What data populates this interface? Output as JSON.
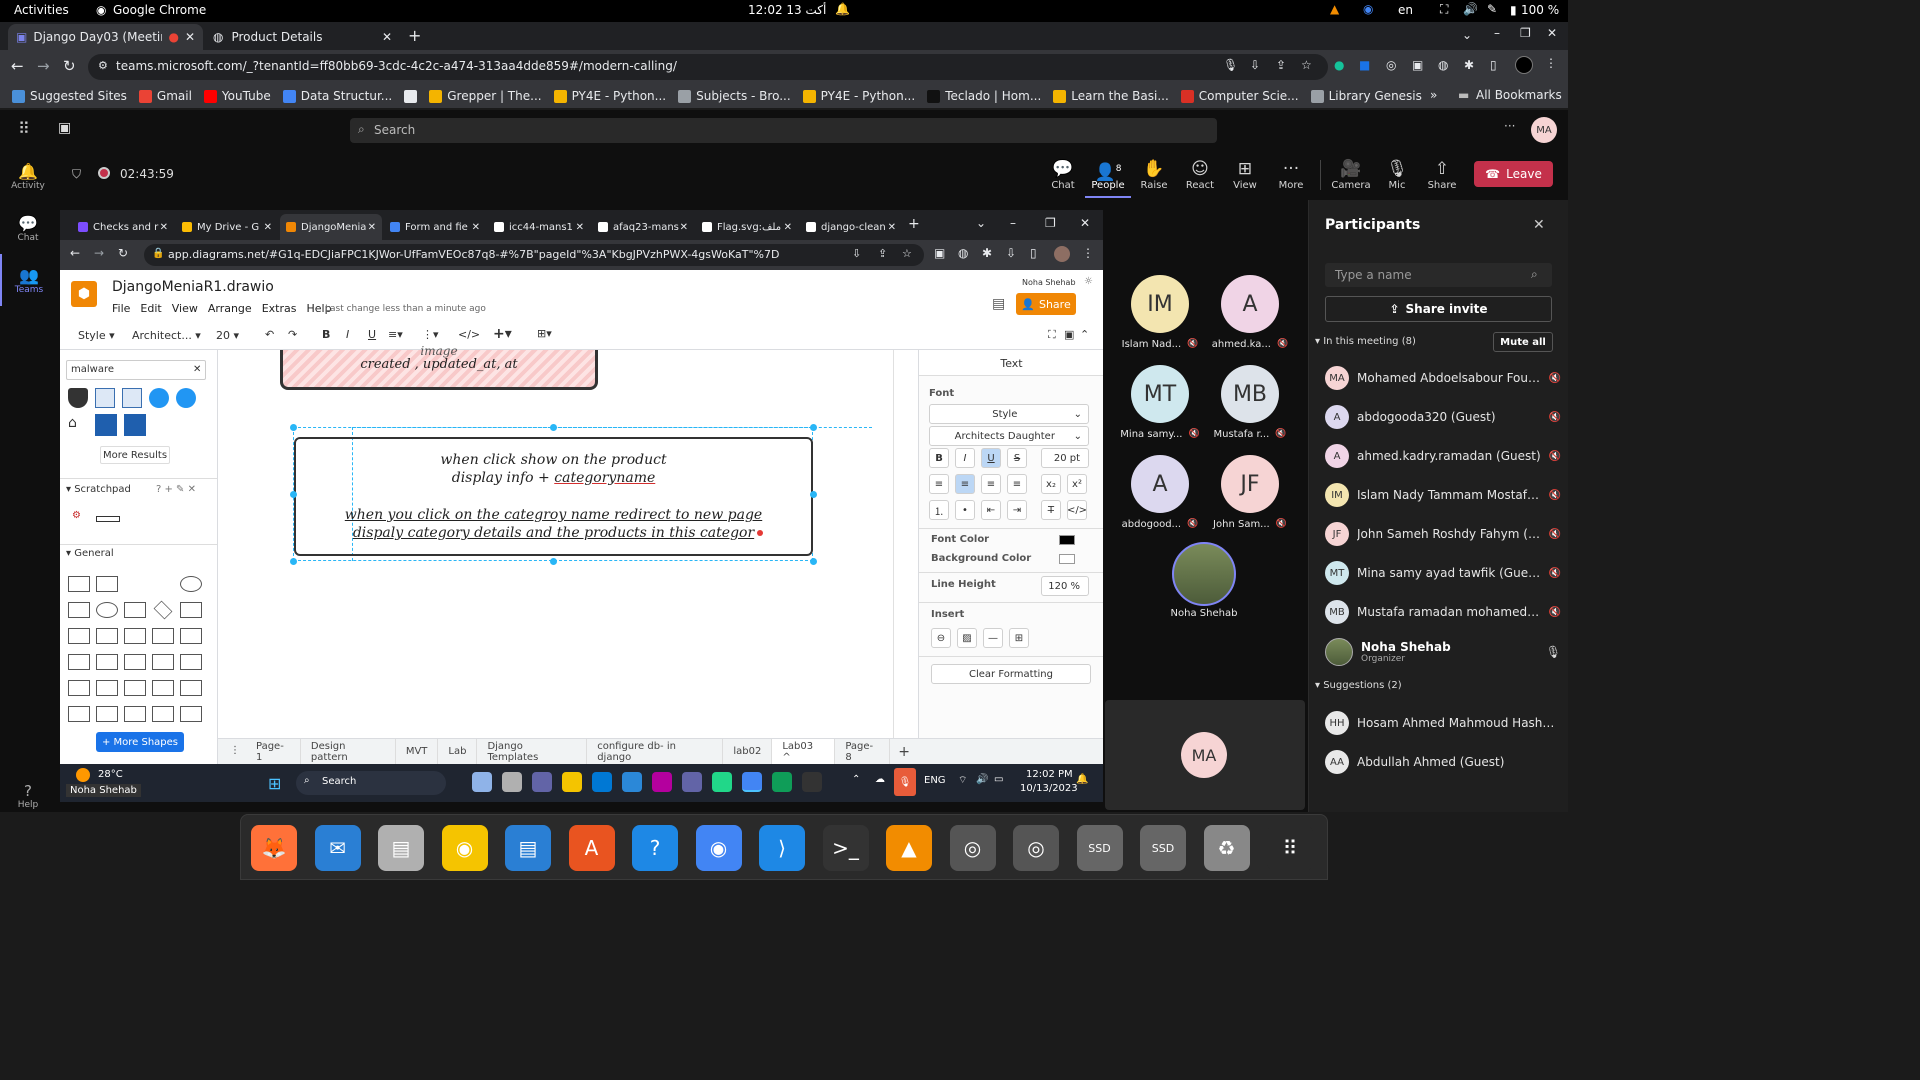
{
  "os_bar": {
    "activities": "Activities",
    "app": "Google Chrome",
    "clock": "12:02  13 أكت",
    "lang": "en",
    "battery": "100 %"
  },
  "chrome": {
    "tabs": [
      {
        "label": "Django Day03 (Meetin",
        "active": true
      },
      {
        "label": "Product Details",
        "active": false
      }
    ],
    "url": "teams.microsoft.com/_?tenantId=ff80bb69-3cdc-4c2c-a474-313aa4dde859#/modern-calling/",
    "bookmarks": [
      {
        "label": "Suggested Sites",
        "color": "#4a90d9"
      },
      {
        "label": "Gmail",
        "color": "#ea4335"
      },
      {
        "label": "YouTube",
        "color": "#ff0000"
      },
      {
        "label": "Data Structur...",
        "color": "#4285f4"
      },
      {
        "label": "",
        "color": "#e8eaed"
      },
      {
        "label": "Grepper | The...",
        "color": "#f4b400"
      },
      {
        "label": "PY4E - Python...",
        "color": "#f4b400"
      },
      {
        "label": "Subjects - Bro...",
        "color": "#9aa0a6"
      },
      {
        "label": "PY4E - Python...",
        "color": "#f4b400"
      },
      {
        "label": "Teclado | Hom...",
        "color": "#111"
      },
      {
        "label": "Learn the Basi...",
        "color": "#f4b400"
      },
      {
        "label": "Computer Scie...",
        "color": "#d93025"
      },
      {
        "label": "Library Genesis",
        "color": "#9aa0a6"
      }
    ],
    "all_bookmarks": "All Bookmarks"
  },
  "teams": {
    "search_placeholder": "Search",
    "user_initials": "MA",
    "rail": [
      {
        "label": "Activity",
        "icon": "bell-icon"
      },
      {
        "label": "Chat",
        "icon": "chat-icon"
      },
      {
        "label": "Teams",
        "icon": "teams-icon"
      }
    ],
    "help": "Help",
    "timer": "02:43:59",
    "call_buttons": [
      {
        "label": "Chat"
      },
      {
        "label": "People",
        "badge": "8"
      },
      {
        "label": "Raise"
      },
      {
        "label": "React"
      },
      {
        "label": "View"
      },
      {
        "label": "More"
      },
      {
        "label": "Camera"
      },
      {
        "label": "Mic"
      },
      {
        "label": "Share"
      }
    ],
    "leave": "Leave"
  },
  "shared": {
    "tabs": [
      "Checks and r",
      "My Drive - G",
      "DjangoMenia",
      "Form and fie",
      "icc44-mans1",
      "afaq23-mans",
      "Flag.svg:ملف",
      "django-clean"
    ],
    "url": "app.diagrams.net/#G1q-EDCJiaFPC1KJWor-UfFamVEOc87q8-#%7B\"pageId\"%3A\"KbgJPVzhPWX-4gsWoKaT\"%7D",
    "file": "DjangoMeniaR1.drawio",
    "menu": [
      "File",
      "Edit",
      "View",
      "Arrange",
      "Extras",
      "Help"
    ],
    "last_change": "Last change less than a minute ago",
    "user": "Noha Shehab",
    "share": "Share",
    "toolbar": {
      "style": "Style",
      "font": "Architect...",
      "size": "20"
    },
    "search_value": "malware",
    "more_results": "More Results",
    "scratchpad": "Scratchpad",
    "general": "General",
    "more_shapes": "+ More Shapes",
    "canvas": {
      "top_box_line1": "image",
      "top_box_line2": "created , updated_at, at",
      "line1": "when click show on the product",
      "line2a": "display info + ",
      "line2b": "categoryname",
      "line3": "when you click on the categroy name redirect to new page",
      "line4": "dispaly category details and the products in this categor"
    },
    "pages": [
      "Page-1",
      "Design pattern",
      "MVT",
      "Lab",
      "Django Templates",
      "configure db- in django",
      "lab02",
      "Lab03 ^",
      "Page-8"
    ],
    "format": {
      "title": "Text",
      "font_label": "Font",
      "style": "Style",
      "font": "Architects Daughter",
      "size": "20 pt",
      "font_color": "Font Color",
      "bg_color": "Background Color",
      "line_height": "Line Height",
      "line_height_val": "120 %",
      "insert": "Insert",
      "clear": "Clear Formatting"
    },
    "win": {
      "weather": "28°C",
      "presenter": "Noha Shehab",
      "search": "Search",
      "lang": "ENG",
      "time": "12:02 PM",
      "date": "10/13/2023"
    }
  },
  "tiles": [
    {
      "initials": "IM",
      "name": "Islam Nad...",
      "color": "#f3e5b0"
    },
    {
      "initials": "A",
      "name": "ahmed.ka...",
      "color": "#f0d4e6"
    },
    {
      "initials": "MT",
      "name": "Mina samy...",
      "color": "#cfe8ee"
    },
    {
      "initials": "MB",
      "name": "Mustafa r...",
      "color": "#dde3ea"
    },
    {
      "initials": "A",
      "name": "abdogood...",
      "color": "#dcd8ef"
    },
    {
      "initials": "JF",
      "name": "John Sam...",
      "color": "#f6d4d4"
    }
  ],
  "presenter_tile": {
    "name": "Noha Shehab"
  },
  "self_tile": {
    "initials": "MA"
  },
  "participants": {
    "title": "Participants",
    "search_placeholder": "Type a name",
    "share_invite": "Share invite",
    "in_meeting": "In this meeting (8)",
    "mute_all": "Mute all",
    "people": [
      {
        "initials": "MA",
        "name": "Mohamed Abdoelsabour Fouad...",
        "color": "#f6d4d4"
      },
      {
        "initials": "A",
        "name": "abdogooda320 (Guest)",
        "color": "#dcd8ef"
      },
      {
        "initials": "A",
        "name": "ahmed.kadry.ramadan (Guest)",
        "color": "#f0d4e6"
      },
      {
        "initials": "IM",
        "name": "Islam Nady Tammam Mostafa (...",
        "color": "#f3e5b0"
      },
      {
        "initials": "JF",
        "name": "John Sameh Roshdy Fahym (Gu...",
        "color": "#f6d4d4"
      },
      {
        "initials": "MT",
        "name": "Mina samy ayad tawfik (Guest)",
        "color": "#cfe8ee"
      },
      {
        "initials": "MB",
        "name": "Mustafa ramadan mohamed ba...",
        "color": "#dde3ea"
      }
    ],
    "organizer": {
      "name": "Noha Shehab",
      "role": "Organizer"
    },
    "suggestions": "Suggestions (2)",
    "suggested": [
      {
        "initials": "HH",
        "name": "Hosam Ahmed Mahmoud Hashem (...",
        "color": "#e8e8e8"
      },
      {
        "initials": "AA",
        "name": "Abdullah Ahmed (Guest)",
        "color": "#e8e8e8"
      }
    ]
  },
  "dock": [
    {
      "name": "firefox-icon",
      "color": "#ff7139"
    },
    {
      "name": "thunderbird-icon",
      "color": "#2a7fd4"
    },
    {
      "name": "files-icon",
      "color": "#b0b0b0"
    },
    {
      "name": "rhythmbox-icon",
      "color": "#f5c400"
    },
    {
      "name": "writer-icon",
      "color": "#2a7fd4"
    },
    {
      "name": "app-center-icon",
      "color": "#e95420"
    },
    {
      "name": "help-icon",
      "color": "#1e88e5"
    },
    {
      "name": "chrome-icon",
      "color": "#4285f4"
    },
    {
      "name": "vscode-icon",
      "color": "#1e88e5"
    },
    {
      "name": "terminal-icon",
      "color": "#333"
    },
    {
      "name": "vlc-icon",
      "color": "#f28c00"
    },
    {
      "name": "disk-icon",
      "color": "#555"
    },
    {
      "name": "disk2-icon",
      "color": "#555"
    },
    {
      "name": "ssd-icon",
      "color": "#666"
    },
    {
      "name": "ssd2-icon",
      "color": "#666"
    },
    {
      "name": "trash-icon",
      "color": "#888"
    },
    {
      "name": "apps-grid-icon",
      "color": "#2a2a2a"
    }
  ]
}
